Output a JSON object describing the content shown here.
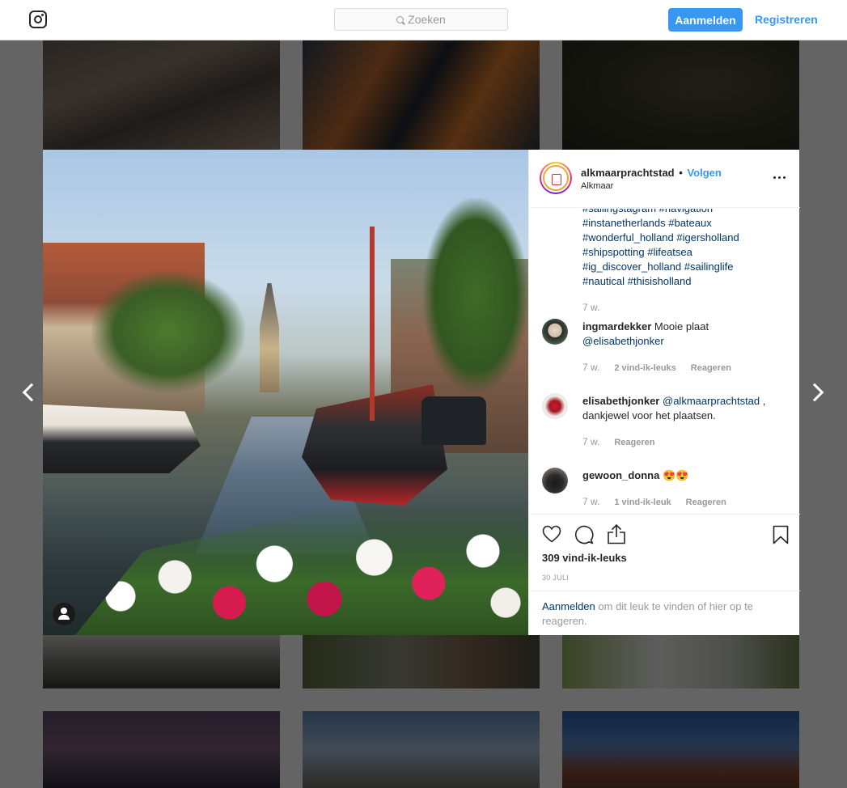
{
  "nav": {
    "search_placeholder": "Zoeken",
    "login_label": "Aanmelden",
    "register_label": "Registreren"
  },
  "post": {
    "username": "alkmaarprachtstad",
    "separator": "•",
    "follow_label": "Volgen",
    "location": "Alkmaar",
    "hashtag_lines": [
      "#sailingstagram #navigation",
      "#instanetherlands #bateaux",
      "#wonderful_holland #igersholland",
      "#shipspotting #lifeatsea",
      "#ig_discover_holland #sailinglife",
      "#nautical #thisisholland"
    ],
    "caption_time": "7 w.",
    "likes": "309 vind-ik-leuks",
    "date": "30 JULI"
  },
  "comments": [
    {
      "username": "ingmardekker",
      "text": " Mooie plaat ",
      "mention": "@elisabethjonker",
      "text_after": "",
      "time": "7 w.",
      "likes": "2 vind-ik-leuks",
      "reply": "Reageren"
    },
    {
      "username": "elisabethjonker",
      "text": " ",
      "mention": "@alkmaarprachtstad",
      "text_after": " , dankjewel voor het plaatsen.",
      "time": "7 w.",
      "likes": "",
      "reply": "Reageren"
    },
    {
      "username": "gewoon_donna",
      "text": " 😍😍",
      "mention": "",
      "text_after": "",
      "time": "7 w.",
      "likes": "1 vind-ik-leuk",
      "reply": "Reageren"
    }
  ],
  "login_prompt": {
    "link": "Aanmelden",
    "text": " om dit leuk te vinden of hier op te reageren."
  },
  "colors": {
    "accent": "#3897f0",
    "link": "#003569",
    "muted": "#999999"
  },
  "icons": {
    "logo": "instagram-icon",
    "like": "heart-icon",
    "comment": "comment-icon",
    "share": "share-icon",
    "save": "bookmark-icon",
    "more": "more-icon"
  }
}
